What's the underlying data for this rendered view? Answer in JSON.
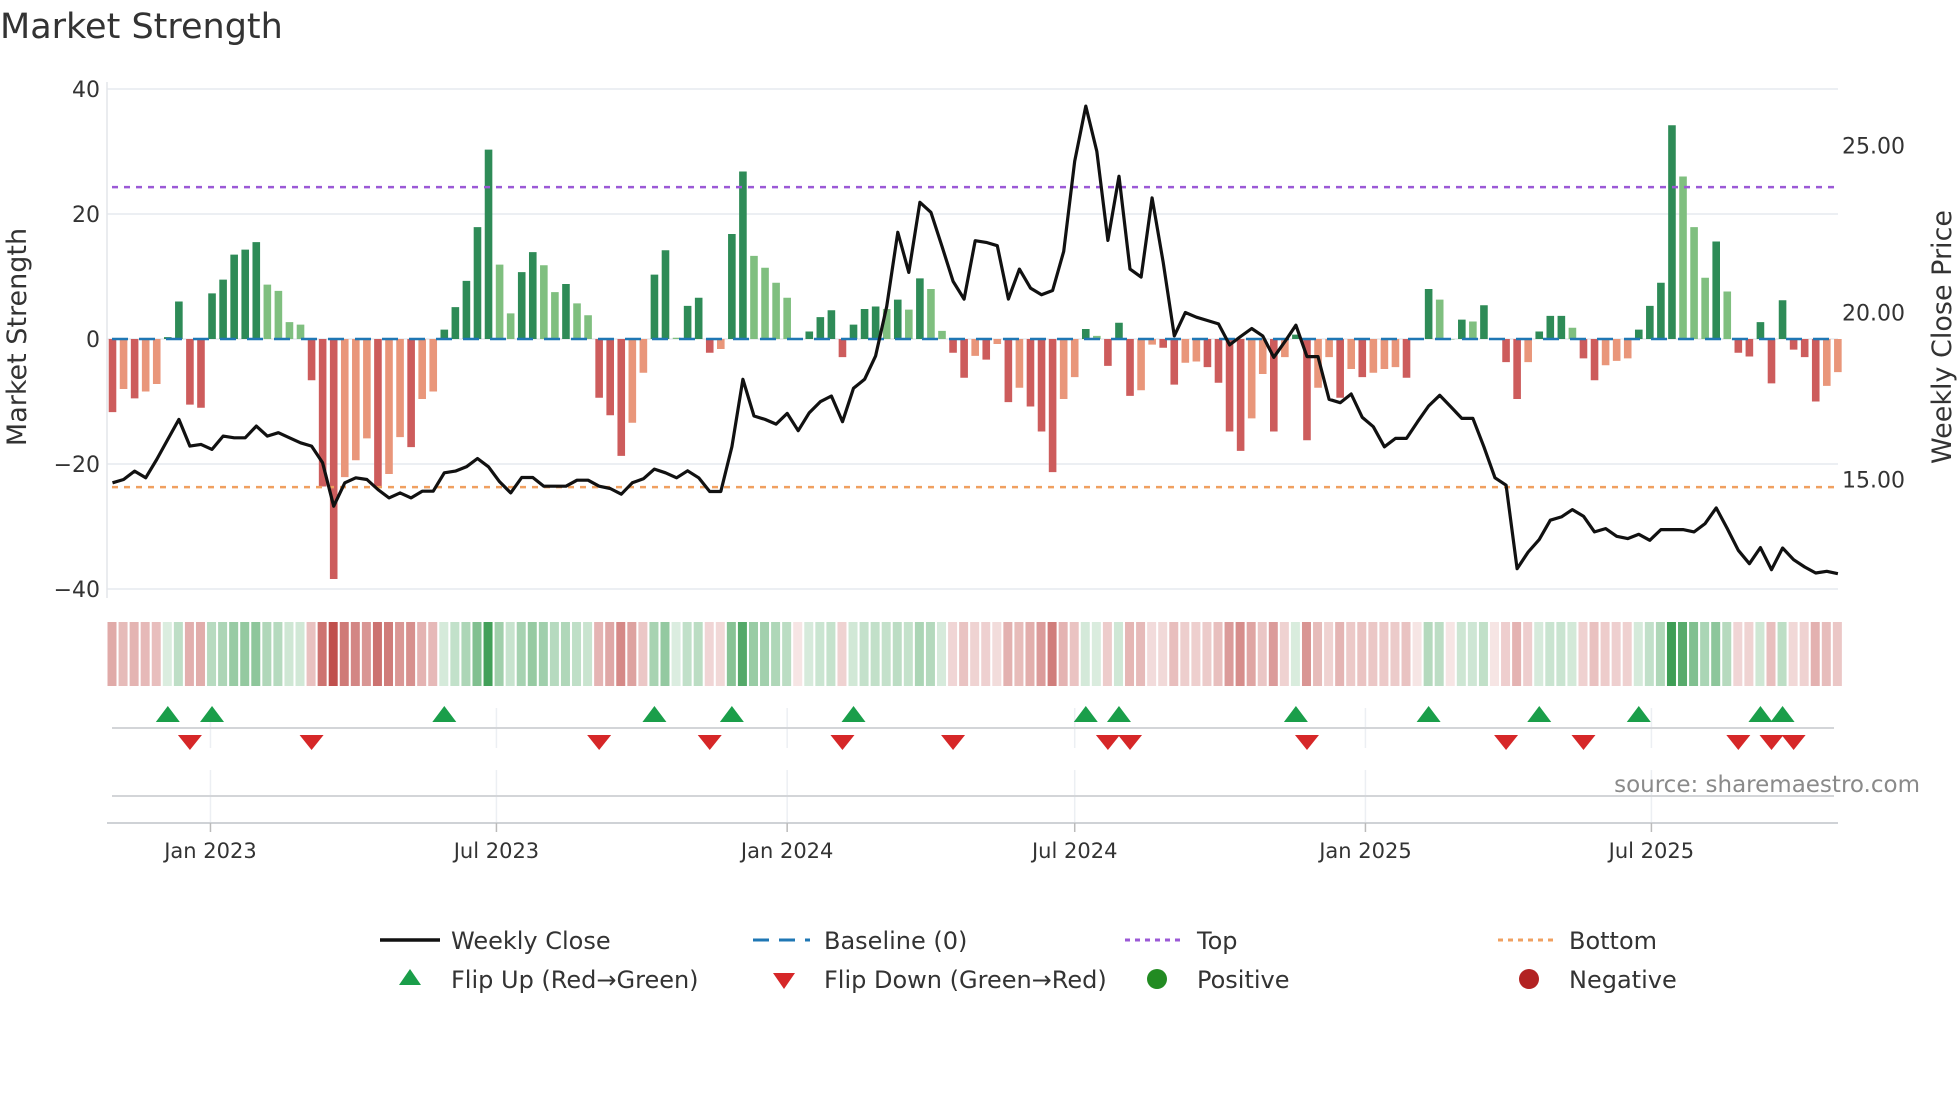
{
  "chart_data": {
    "type": "bar+line",
    "title": "Market Strength",
    "ylabel_left": "Market Strength",
    "ylabel_right": "Weekly Close Price",
    "ylim_left": [
      -40,
      40
    ],
    "yticks_left": [
      "40",
      "20",
      "0",
      "−20",
      "−40"
    ],
    "yticks_left_values": [
      40,
      20,
      0,
      -20,
      -40
    ],
    "yticks_right": [
      "25.00",
      "20.00",
      "15.00"
    ],
    "yticks_right_values": [
      25,
      20,
      15
    ],
    "xticks": [
      "Jan 2023",
      "Jul 2023",
      "Jan 2024",
      "Jul 2024",
      "Jan 2025",
      "Jul 2025"
    ],
    "xticks_dates": [
      "2023-01-01",
      "2023-07-01",
      "2024-01-01",
      "2024-07-01",
      "2025-01-01",
      "2025-07-01"
    ],
    "start_week": "2022-10-31",
    "interval_days": 7,
    "top_level": 24.3,
    "bottom_level": -23.7,
    "baseline": 0,
    "strength": [
      -11.7,
      -8.0,
      -9.5,
      -8.4,
      -7.2,
      0.3,
      6.0,
      -10.5,
      -11.0,
      7.3,
      9.5,
      13.5,
      14.3,
      15.5,
      8.7,
      7.7,
      2.7,
      2.3,
      -6.6,
      -23.6,
      -38.4,
      -22.1,
      -19.4,
      -15.9,
      -23.7,
      -21.6,
      -15.7,
      -17.3,
      -9.6,
      -8.4,
      1.5,
      5.1,
      9.3,
      17.9,
      30.3,
      11.9,
      4.1,
      10.7,
      13.9,
      11.8,
      7.5,
      8.8,
      5.7,
      3.8,
      -9.4,
      -12.2,
      -18.7,
      -13.4,
      -5.4,
      10.3,
      14.2,
      0.2,
      5.3,
      6.6,
      -2.2,
      -1.6,
      16.8,
      26.8,
      13.3,
      11.4,
      9.0,
      6.6,
      0,
      1.2,
      3.5,
      4.6,
      -2.9,
      2.3,
      4.8,
      5.2,
      4.8,
      6.3,
      4.7,
      9.7,
      8.0,
      1.3,
      -2.2,
      -6.2,
      -2.7,
      -3.3,
      -0.8,
      -10.1,
      -7.8,
      -10.8,
      -14.8,
      -21.3,
      -9.6,
      -6.1,
      1.6,
      0.5,
      -4.3,
      2.6,
      -9.1,
      -8.2,
      -0.9,
      -1.4,
      -7.3,
      -3.8,
      -3.6,
      -4.5,
      -7.0,
      -14.8,
      -17.9,
      -12.7,
      -5.6,
      -14.8,
      -2.9,
      0.7,
      -16.2,
      -7.8,
      -2.9,
      -9.4,
      -4.8,
      -6.1,
      -5.4,
      -4.8,
      -4.5,
      -6.2,
      0,
      8.0,
      6.3,
      0,
      3.1,
      2.8,
      5.4,
      0,
      -3.7,
      -9.6,
      -3.7,
      1.2,
      3.7,
      3.7,
      1.8,
      -3.1,
      -6.6,
      -4.2,
      -3.5,
      -3.1,
      1.5,
      5.3,
      9.0,
      34.2,
      26.0,
      17.9,
      9.8,
      15.6,
      7.6,
      -2.2,
      -2.8,
      2.7,
      -7.1,
      6.2,
      -1.7,
      -2.9,
      -10.0,
      -7.5,
      -5.3
    ],
    "weekly_close": [
      14.9,
      15.0,
      15.25,
      15.05,
      15.6,
      16.2,
      16.8,
      16.0,
      16.05,
      15.9,
      16.3,
      16.25,
      16.25,
      16.6,
      16.3,
      16.4,
      16.25,
      16.1,
      16.0,
      15.5,
      14.2,
      14.9,
      15.05,
      15.0,
      14.7,
      14.45,
      14.6,
      14.45,
      14.65,
      14.65,
      15.2,
      15.25,
      15.38,
      15.63,
      15.38,
      14.93,
      14.6,
      15.06,
      15.06,
      14.8,
      14.8,
      14.8,
      14.98,
      14.98,
      14.8,
      14.73,
      14.56,
      14.9,
      15.02,
      15.31,
      15.2,
      15.05,
      15.26,
      15.05,
      14.64,
      14.64,
      15.98,
      18.0,
      16.9,
      16.8,
      16.66,
      16.98,
      16.46,
      17.0,
      17.33,
      17.5,
      16.73,
      17.73,
      18.0,
      18.7,
      20.18,
      22.4,
      21.2,
      23.3,
      23.0,
      21.98,
      20.93,
      20.4,
      22.15,
      22.1,
      22.0,
      20.4,
      21.3,
      20.73,
      20.53,
      20.66,
      21.83,
      24.53,
      26.18,
      24.83,
      22.16,
      24.08,
      21.3,
      21.06,
      23.43,
      21.5,
      19.3,
      20.0,
      19.86,
      19.76,
      19.66,
      19.03,
      19.28,
      19.52,
      19.3,
      18.66,
      19.13,
      19.62,
      18.68,
      18.68,
      17.4,
      17.3,
      17.56,
      16.86,
      16.58,
      15.98,
      16.23,
      16.23,
      16.73,
      17.2,
      17.52,
      17.18,
      16.83,
      16.83,
      15.98,
      15.05,
      14.83,
      12.33,
      12.83,
      13.2,
      13.78,
      13.88,
      14.1,
      13.9,
      13.43,
      13.53,
      13.3,
      13.23,
      13.36,
      13.18,
      13.5,
      13.5,
      13.5,
      13.43,
      13.68,
      14.15,
      13.53,
      12.88,
      12.48,
      12.96,
      12.3,
      12.95,
      12.6,
      12.38,
      12.2,
      12.25,
      12.18
    ],
    "flip_up_weeks": [
      6,
      10,
      31,
      50,
      57,
      68,
      89,
      92,
      108,
      120,
      130,
      139,
      150,
      152
    ],
    "flip_down_weeks": [
      8,
      19,
      45,
      55,
      67,
      77,
      91,
      93,
      109,
      127,
      134,
      148,
      151,
      153
    ],
    "legend": {
      "weekly_close": "Weekly Close",
      "baseline": "Baseline (0)",
      "top": "Top",
      "bottom": "Bottom",
      "flip_up": "Flip Up (Red→Green)",
      "flip_down": "Flip Down (Green→Red)",
      "positive": "Positive",
      "negative": "Negative"
    },
    "legend_placement": "bottom",
    "source": "source: sharemaestro.com"
  },
  "colors": {
    "pos_strong": "#2e8b57",
    "pos_weak": "#7fbf7f",
    "neg_strong": "#cd5c5c",
    "neg_weak": "#e9967a",
    "line": "#111111",
    "baseline": "#1f77b4",
    "top": "#9b59d6",
    "bottom": "#f0a060",
    "flip_up": "#1a9e4a",
    "flip_down": "#d62728",
    "positive": "#228b22",
    "negative": "#b22222",
    "grid": "#eceff3"
  }
}
